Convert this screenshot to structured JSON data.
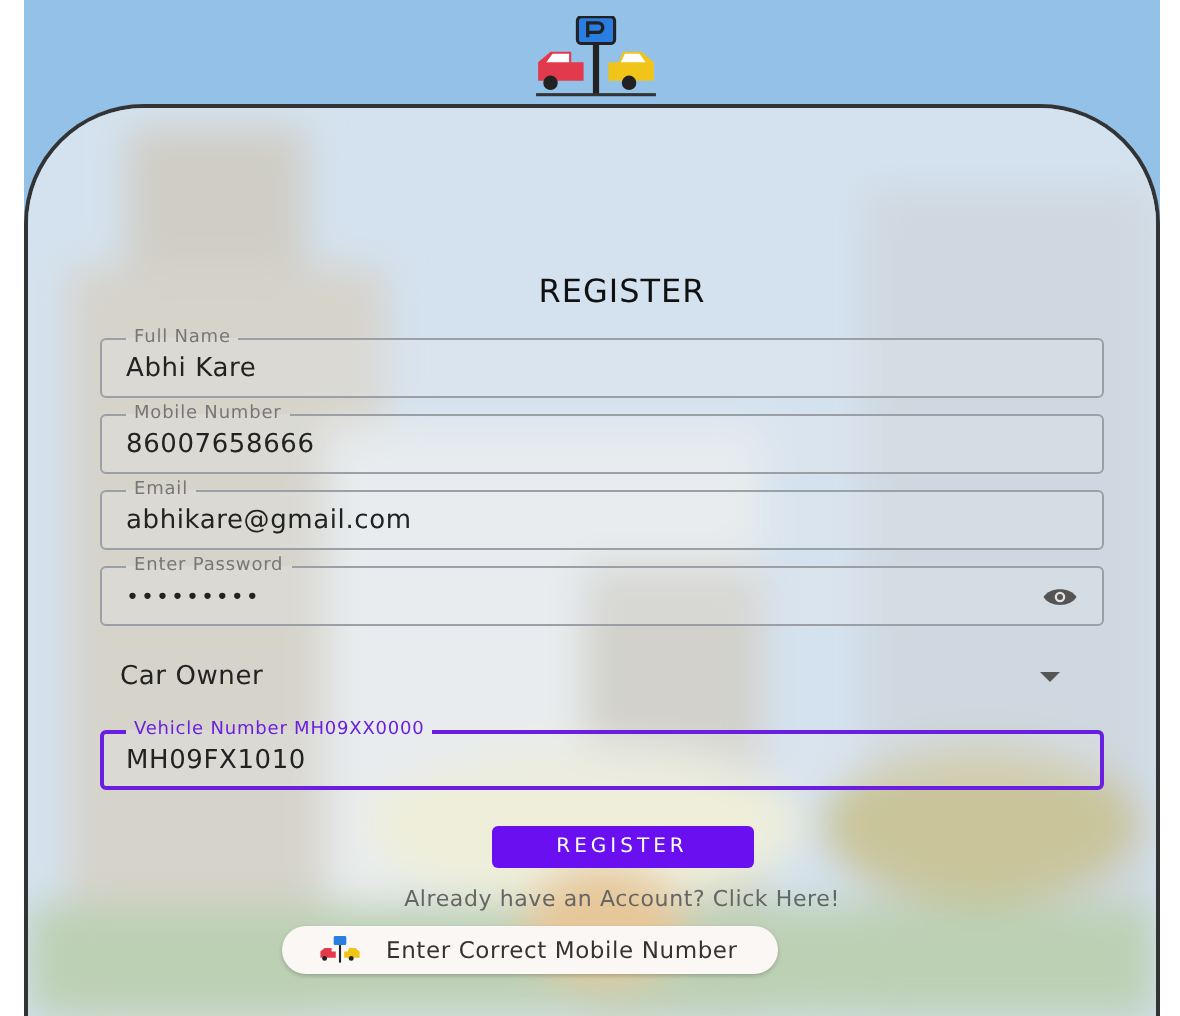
{
  "title": "REGISTER",
  "fields": [
    {
      "kind": "text",
      "label": "Full Name",
      "value": "Abhi Kare",
      "focused": false
    },
    {
      "kind": "text",
      "label": "Mobile Number",
      "value": "86007658666",
      "focused": false
    },
    {
      "kind": "text",
      "label": "Email",
      "value": "abhikare@gmail.com",
      "focused": false
    },
    {
      "kind": "password",
      "label": "Enter Password",
      "value": "•••••••••",
      "focused": false
    },
    {
      "kind": "select",
      "value": "Car Owner",
      "focused": false
    },
    {
      "kind": "text",
      "label": "Vehicle Number MH09XX0000",
      "value": "MH09FX1010",
      "focused": true
    }
  ],
  "button": "REGISTER",
  "link": "Already have an Account? Click Here!",
  "toast": {
    "message": "Enter Correct Mobile Number"
  }
}
